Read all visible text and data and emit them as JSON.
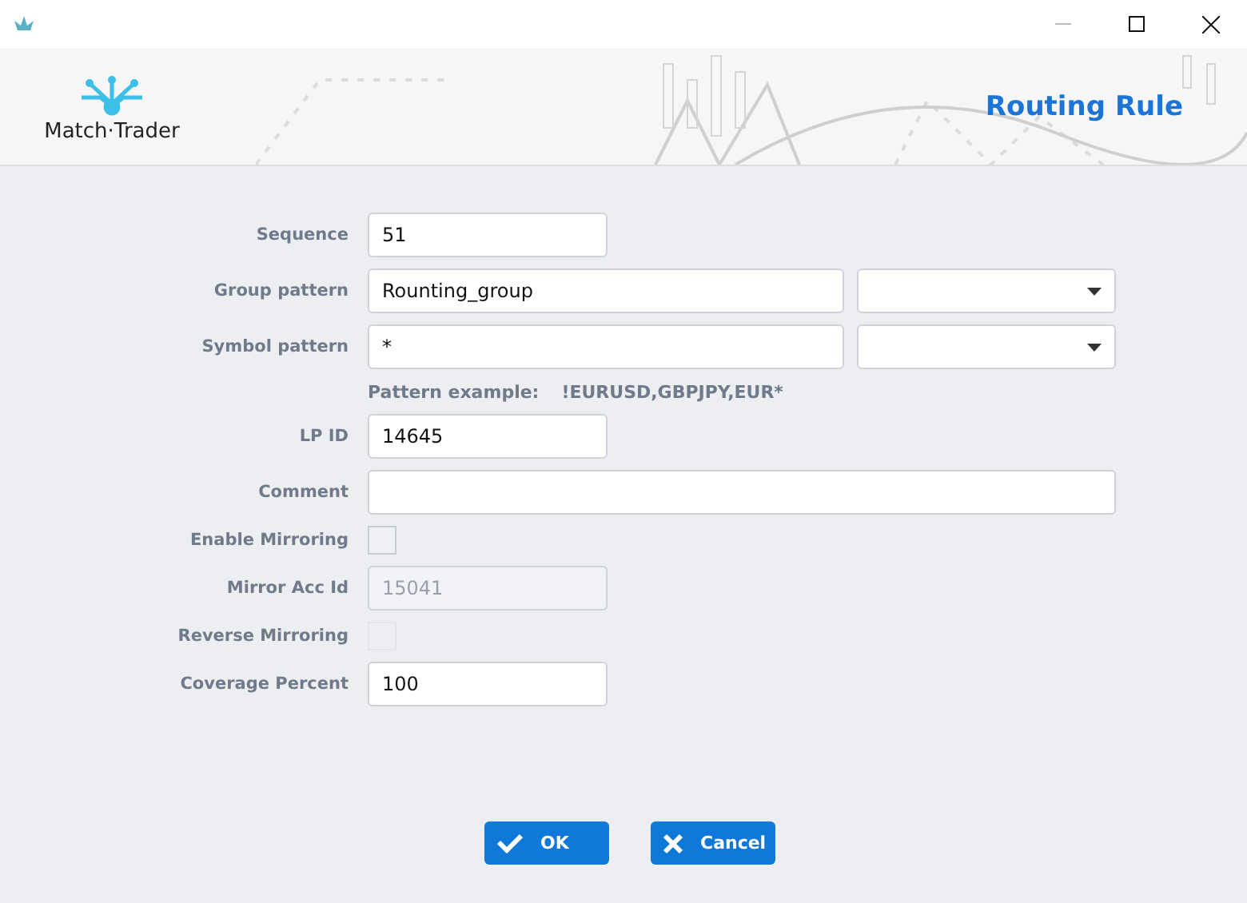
{
  "header": {
    "logo_text": "Match·Trader",
    "title": "Routing Rule"
  },
  "fields": [
    {
      "kind": "short",
      "label": "Sequence",
      "value": "51",
      "disabled": false
    },
    {
      "kind": "combo",
      "label": "Group pattern",
      "value": "Rounting_group",
      "disabled": false
    },
    {
      "kind": "combo",
      "label": "Symbol pattern",
      "value": "*",
      "disabled": false
    },
    {
      "kind": "hint",
      "label": "Pattern example:",
      "value": "!EURUSD,GBPJPY,EUR*"
    },
    {
      "kind": "short",
      "label": "LP ID",
      "value": "14645",
      "disabled": false
    },
    {
      "kind": "wide",
      "label": "Comment",
      "disabled": false
    },
    {
      "kind": "checkbox",
      "label": "Enable Mirroring",
      "checked": false,
      "disabled": false
    },
    {
      "kind": "short",
      "label": "Mirror Acc Id",
      "value": "15041",
      "disabled": true
    },
    {
      "kind": "checkbox",
      "label": "Reverse Mirroring",
      "checked": false,
      "disabled": true
    },
    {
      "kind": "short",
      "label": "Coverage Percent",
      "value": "100",
      "disabled": false
    }
  ],
  "buttons": [
    {
      "kind": "ok",
      "label": "OK"
    },
    {
      "kind": "cancel",
      "label": "Cancel"
    }
  ]
}
